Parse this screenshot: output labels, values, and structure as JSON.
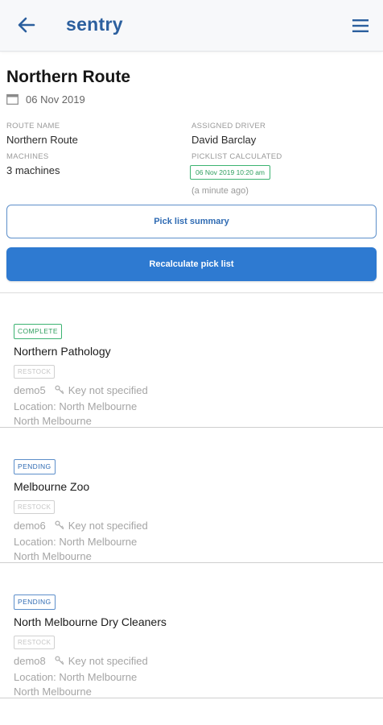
{
  "header": {
    "app_title": "sentry"
  },
  "route": {
    "title": "Northern Route",
    "date": "06 Nov 2019",
    "route_name_label": "ROUTE NAME",
    "route_name": "Northern Route",
    "driver_label": "ASSIGNED DRIVER",
    "driver": "David Barclay",
    "machines_label": "MACHINES",
    "machines": "3 machines",
    "picklist_label": "PICKLIST CALCULATED",
    "picklist_time": "06 Nov 2019 10:20 am",
    "picklist_ago": "(a minute ago)"
  },
  "actions": {
    "summary_label": "Pick list summary",
    "recalculate_label": "Recalculate pick list"
  },
  "stops": [
    {
      "status": "COMPLETE",
      "name": "Northern Pathology",
      "restock": "RESTOCK",
      "machine": "demo5",
      "key": "Key not specified",
      "location": "Location: North Melbourne",
      "suburb": "North Melbourne"
    },
    {
      "status": "PENDING",
      "name": "Melbourne Zoo",
      "restock": "RESTOCK",
      "machine": "demo6",
      "key": "Key not specified",
      "location": "Location: North Melbourne",
      "suburb": "North Melbourne"
    },
    {
      "status": "PENDING",
      "name": "North Melbourne Dry Cleaners",
      "restock": "RESTOCK",
      "machine": "demo8",
      "key": "Key not specified",
      "location": "Location: North Melbourne",
      "suburb": "North Melbourne"
    }
  ],
  "colors": {
    "brand": "#2b5f9e",
    "primary_button": "#2e7ad1",
    "complete": "#3cb371",
    "pending": "#5d8fca"
  },
  "icons": {
    "back": "arrow-left-icon",
    "menu": "hamburger-menu-icon",
    "date": "calendar-icon",
    "key": "key-icon"
  }
}
